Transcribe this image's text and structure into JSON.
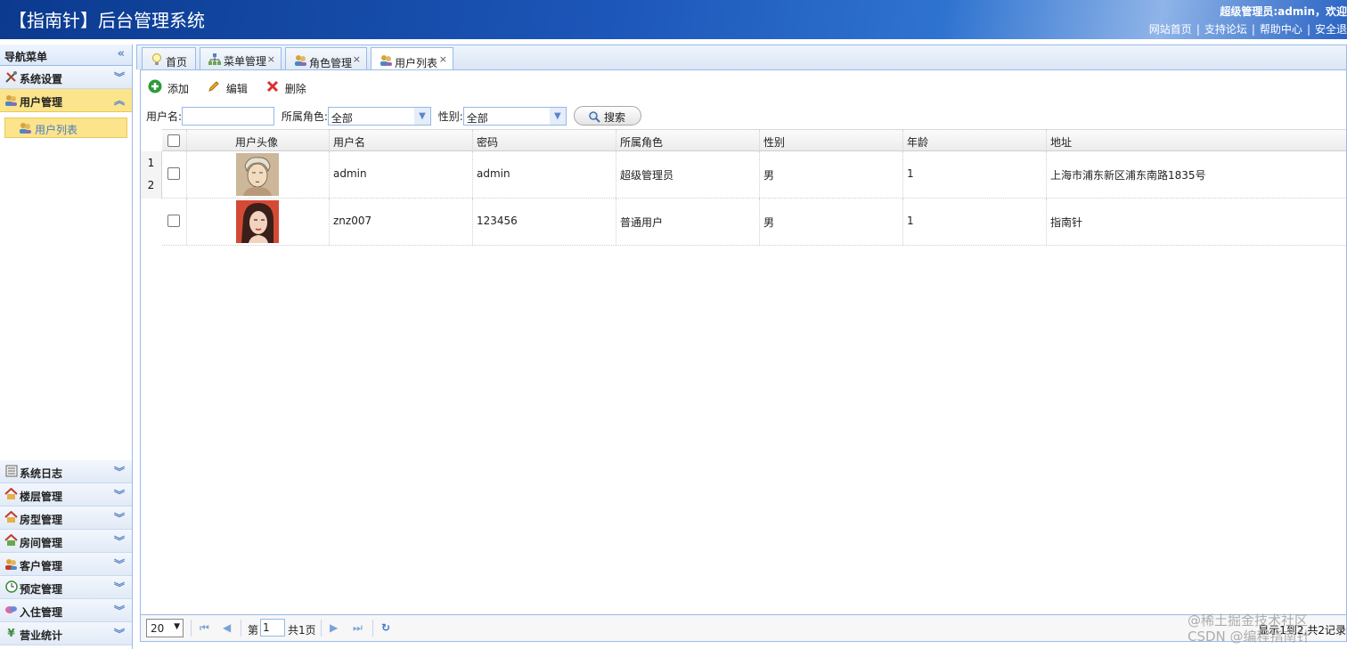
{
  "header": {
    "title": "【指南针】后台管理系统",
    "welcome": "超级管理员:admin，欢迎",
    "links": [
      "网站首页",
      "支持论坛",
      "帮助中心",
      "安全退"
    ]
  },
  "sidebar": {
    "title": "导航菜单",
    "top_panels": [
      {
        "label": "系统设置",
        "icon": "tools-icon"
      },
      {
        "label": "用户管理",
        "icon": "users-icon",
        "active": true
      }
    ],
    "sub_items": [
      {
        "label": "用户列表",
        "icon": "users-icon"
      }
    ],
    "bottom_panels": [
      {
        "label": "系统日志",
        "icon": "log-icon"
      },
      {
        "label": "楼层管理",
        "icon": "home-icon"
      },
      {
        "label": "房型管理",
        "icon": "home-icon"
      },
      {
        "label": "房间管理",
        "icon": "home-icon"
      },
      {
        "label": "客户管理",
        "icon": "customer-icon"
      },
      {
        "label": "预定管理",
        "icon": "clock-icon"
      },
      {
        "label": "入住管理",
        "icon": "checkin-icon"
      },
      {
        "label": "营业统计",
        "icon": "yuan-icon"
      }
    ]
  },
  "tabs": [
    {
      "label": "首页",
      "icon": "bulb-icon",
      "closable": false
    },
    {
      "label": "菜单管理",
      "icon": "tree-icon",
      "closable": true
    },
    {
      "label": "角色管理",
      "icon": "users-icon",
      "closable": true
    },
    {
      "label": "用户列表",
      "icon": "users-icon",
      "closable": true,
      "selected": true
    }
  ],
  "toolbar": {
    "add": "添加",
    "edit": "编辑",
    "delete": "删除"
  },
  "search": {
    "username_label": "用户名:",
    "username_value": "",
    "role_label": "所属角色:",
    "role_value": "全部",
    "gender_label": "性别:",
    "gender_value": "全部",
    "button": "搜索"
  },
  "grid": {
    "columns": [
      "用户头像",
      "用户名",
      "密码",
      "所属角色",
      "性别",
      "年龄",
      "地址"
    ],
    "rows": [
      {
        "num": "1",
        "username": "admin",
        "password": "admin",
        "role": "超级管理员",
        "gender": "男",
        "age": "1",
        "address": "上海市浦东新区浦东南路1835号"
      },
      {
        "num": "2",
        "username": "znz007",
        "password": "123456",
        "role": "普通用户",
        "gender": "男",
        "age": "1",
        "address": "指南针"
      }
    ]
  },
  "pager": {
    "page_size": "20",
    "page_prefix": "第",
    "page_value": "1",
    "page_total": "共1页",
    "info": "显示1到2,共2记录"
  },
  "watermark": {
    "line1": "@稀土掘金技术社区",
    "line2": "CSDN @编程指南针"
  },
  "colors": {
    "header_blue": "#1c56b8",
    "active_yellow": "#fbe48b",
    "border_blue": "#99bbe8"
  }
}
